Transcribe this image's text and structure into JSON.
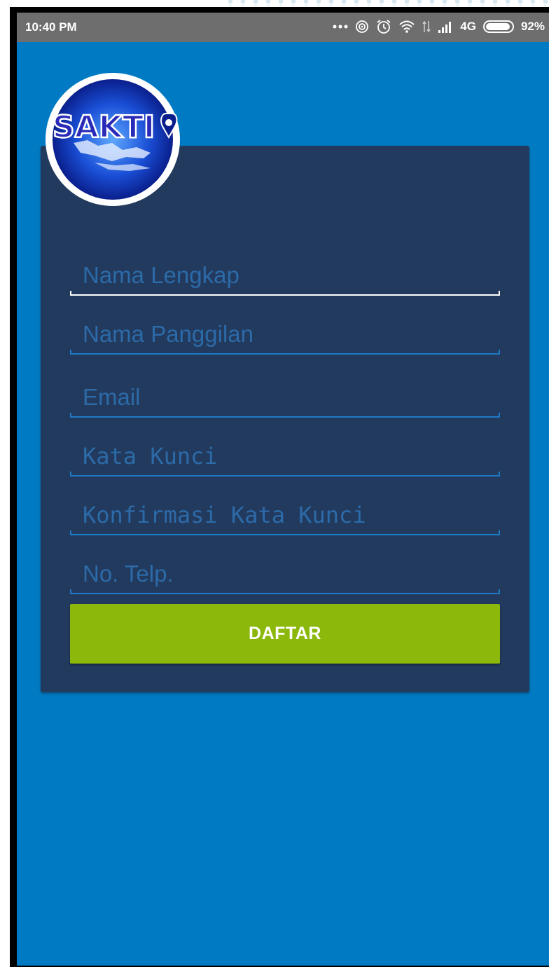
{
  "status_bar": {
    "time": "10:40 PM",
    "network": "4G",
    "battery": "92%",
    "icons": [
      "more-dots-icon",
      "hotspot-icon",
      "alarm-icon",
      "wifi-icon",
      "data-transfer-icon",
      "signal-icon",
      "battery-icon"
    ]
  },
  "colors": {
    "background": "#007bc3",
    "card": "#223a5e",
    "placeholder": "#2c6aa8",
    "underline": "#1e7ac6",
    "button": "#8bb80a",
    "status_bar": "#6e6e6e"
  },
  "logo": {
    "text": "SAKTI"
  },
  "form": {
    "fields": [
      {
        "placeholder": "Nama Lengkap"
      },
      {
        "placeholder": "Nama Panggilan"
      },
      {
        "placeholder": "Email"
      },
      {
        "placeholder": "Kata Kunci"
      },
      {
        "placeholder": "Konfirmasi Kata Kunci"
      },
      {
        "placeholder": "No. Telp."
      }
    ],
    "submit_label": "DAFTAR"
  }
}
